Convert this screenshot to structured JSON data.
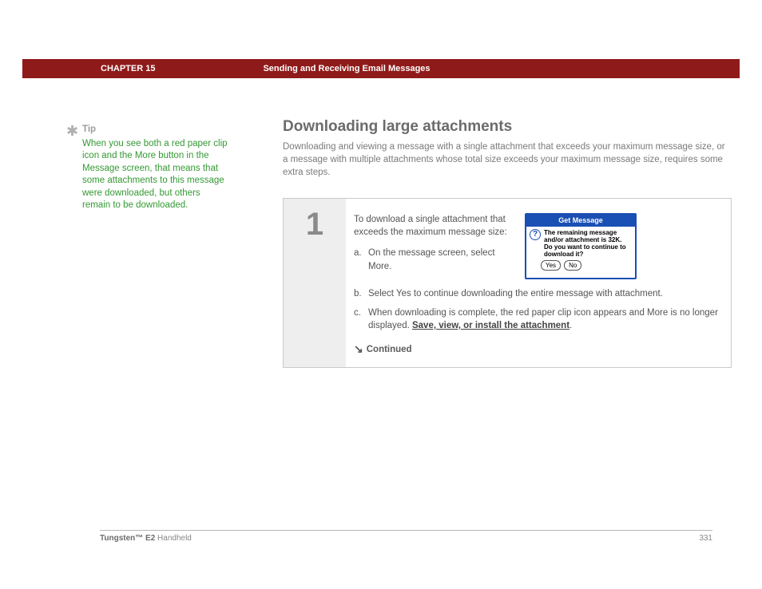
{
  "header": {
    "chapter": "CHAPTER 15",
    "title": "Sending and Receiving Email Messages"
  },
  "tip": {
    "heading": "Tip",
    "text": "When you see both a red paper clip icon and the More button in the Message screen, that means that some attachments to this message were downloaded, but others remain to be downloaded."
  },
  "main": {
    "heading": "Downloading large attachments",
    "intro": "Downloading and viewing a message with a single attachment that exceeds your maximum message size, or a message with multiple attachments whose total size exceeds your maximum message size, requires some extra steps."
  },
  "step": {
    "number": "1",
    "lead": "To download a single attachment that exceeds the maximum message size:",
    "a": "On the message screen, select More.",
    "b": "Select Yes to continue downloading the entire message with attachment.",
    "c_prefix": "When downloading is complete, the red paper clip icon appears and More is no longer displayed. ",
    "c_link": "Save, view, or install the attachment",
    "continued": "Continued"
  },
  "dialog": {
    "title": "Get Message",
    "message": "The remaining message and/or attachment is 32K. Do you want to continue to download it?",
    "yes": "Yes",
    "no": "No"
  },
  "footer": {
    "product_bold": "Tungsten™ E2",
    "product_rest": " Handheld",
    "page": "331"
  }
}
